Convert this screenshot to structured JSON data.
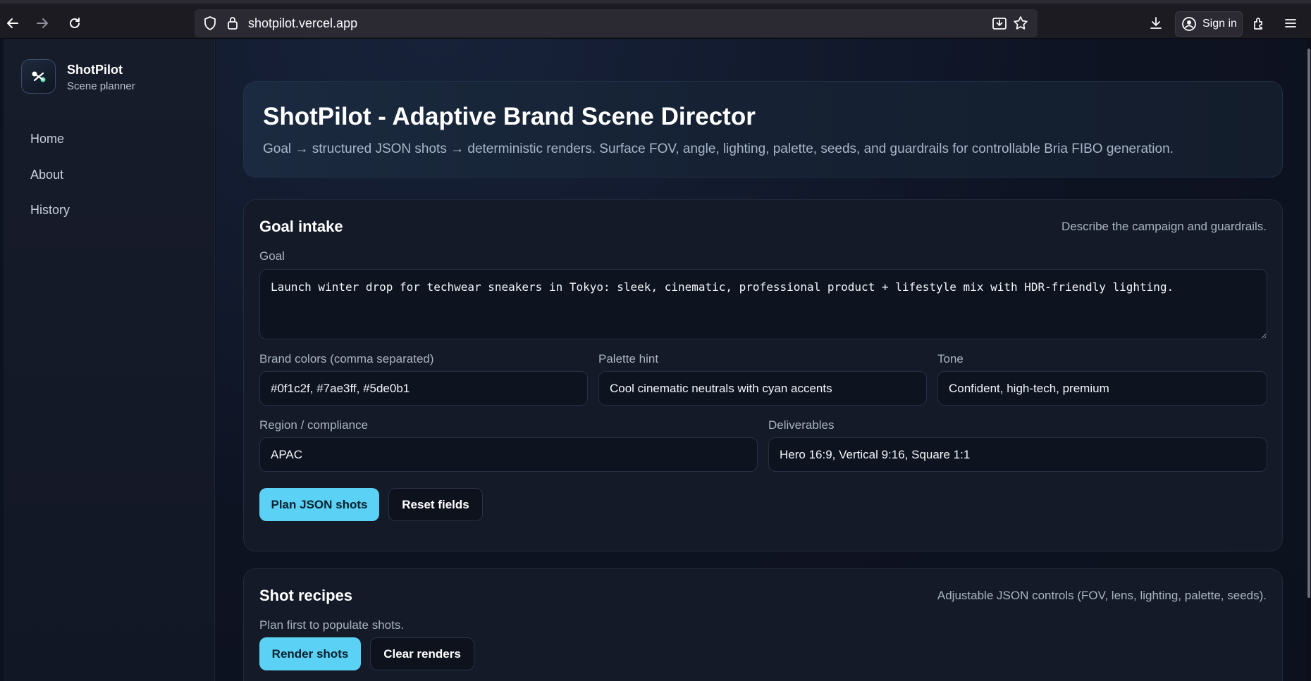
{
  "browser": {
    "url": "shotpilot.vercel.app",
    "sign_in_label": "Sign in"
  },
  "sidebar": {
    "brand_name": "ShotPilot",
    "brand_subtitle": "Scene planner",
    "items": [
      {
        "label": "Home"
      },
      {
        "label": "About"
      },
      {
        "label": "History"
      }
    ]
  },
  "hero": {
    "title": "ShotPilot - Adaptive Brand Scene Director",
    "subtitle": "Goal → structured JSON shots → deterministic renders. Surface FOV, angle, lighting, palette, seeds, and guardrails for controllable Bria FIBO generation."
  },
  "goal_intake": {
    "title": "Goal intake",
    "hint": "Describe the campaign and guardrails.",
    "goal_label": "Goal",
    "goal_value": "Launch winter drop for techwear sneakers in Tokyo: sleek, cinematic, professional product + lifestyle mix with HDR-friendly lighting.",
    "brand_colors_label": "Brand colors (comma separated)",
    "brand_colors_value": "#0f1c2f, #7ae3ff, #5de0b1",
    "palette_label": "Palette hint",
    "palette_value": "Cool cinematic neutrals with cyan accents",
    "tone_label": "Tone",
    "tone_value": "Confident, high-tech, premium",
    "region_label": "Region / compliance",
    "region_value": "APAC",
    "deliverables_label": "Deliverables",
    "deliverables_value": "Hero 16:9, Vertical 9:16, Square 1:1",
    "plan_button": "Plan JSON shots",
    "reset_button": "Reset fields"
  },
  "shot_recipes": {
    "title": "Shot recipes",
    "hint": "Adjustable JSON controls (FOV, lens, lighting, palette, seeds).",
    "empty_text": "Plan first to populate shots.",
    "render_button": "Render shots",
    "clear_button": "Clear renders"
  },
  "colors": {
    "accent": "#5ad1f5",
    "background": "#0d1220",
    "card": "#141a27"
  }
}
